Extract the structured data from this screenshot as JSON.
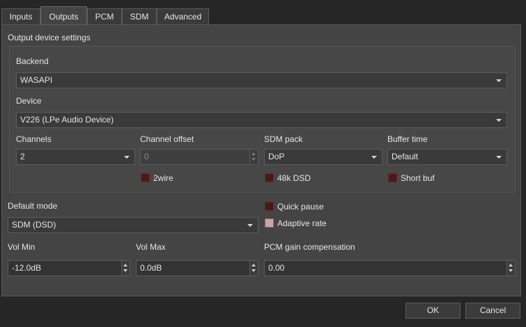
{
  "tabs": [
    {
      "label": "Inputs"
    },
    {
      "label": "Outputs"
    },
    {
      "label": "PCM"
    },
    {
      "label": "SDM"
    },
    {
      "label": "Advanced"
    }
  ],
  "active_tab": "Outputs",
  "group": {
    "title": "Output device settings"
  },
  "backend": {
    "label": "Backend",
    "value": "WASAPI"
  },
  "device": {
    "label": "Device",
    "value": "V226 (LPe Audio Device)"
  },
  "channels": {
    "label": "Channels",
    "value": "2"
  },
  "channel_offset": {
    "label": "Channel offset",
    "value": "0",
    "enabled": false
  },
  "sdm_pack": {
    "label": "SDM pack",
    "value": "DoP"
  },
  "buffer_time": {
    "label": "Buffer time",
    "value": "Default"
  },
  "checkboxes": {
    "twowire": {
      "label": "2wire",
      "checked": false
    },
    "dsd48k": {
      "label": "48k DSD",
      "checked": false
    },
    "short_buf": {
      "label": "Short buf",
      "checked": false
    },
    "quick_pause": {
      "label": "Quick pause",
      "checked": false
    },
    "adaptive_rate": {
      "label": "Adaptive rate",
      "checked": true
    }
  },
  "default_mode": {
    "label": "Default mode",
    "value": "SDM (DSD)"
  },
  "vol_min": {
    "label": "Vol Min",
    "value": "-12.0dB"
  },
  "vol_max": {
    "label": "Vol Max",
    "value": "0.0dB"
  },
  "pcm_gain": {
    "label": "PCM gain compensation",
    "value": "0.00"
  },
  "buttons": {
    "ok": "OK",
    "cancel": "Cancel"
  },
  "colors": {
    "checkbox_off": "#4a1a1a",
    "checkbox_on": "#c9a6a6",
    "panel": "#444444",
    "background": "#262626"
  }
}
